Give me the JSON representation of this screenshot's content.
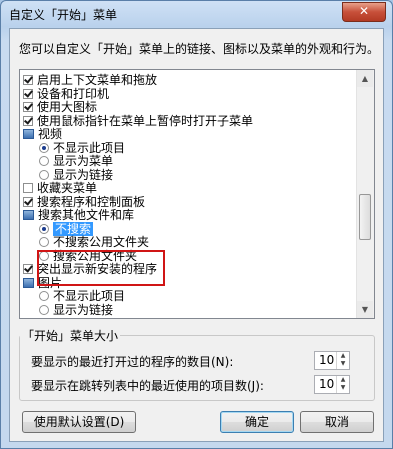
{
  "window": {
    "title": "自定义「开始」菜单",
    "close_glyph": "✕"
  },
  "description": "您可以自定义「开始」菜单上的链接、图标以及菜单的外观和行为。",
  "list_items": [
    {
      "kind": "checkbox",
      "checked": true,
      "label": "启用上下文菜单和拖放"
    },
    {
      "kind": "checkbox",
      "checked": true,
      "label": "设备和打印机"
    },
    {
      "kind": "checkbox",
      "checked": true,
      "label": "使用大图标"
    },
    {
      "kind": "checkbox",
      "checked": true,
      "label": "使用鼠标指针在菜单上暂停时打开子菜单"
    },
    {
      "kind": "group",
      "label": "视频"
    },
    {
      "kind": "radio",
      "checked": true,
      "label": "不显示此项目"
    },
    {
      "kind": "radio",
      "checked": false,
      "label": "显示为菜单"
    },
    {
      "kind": "radio",
      "checked": false,
      "label": "显示为链接"
    },
    {
      "kind": "checkbox",
      "checked": false,
      "label": "收藏夹菜单"
    },
    {
      "kind": "checkbox",
      "checked": true,
      "label": "搜索程序和控制面板"
    },
    {
      "kind": "group",
      "label": "搜索其他文件和库"
    },
    {
      "kind": "radio",
      "checked": true,
      "label": "不搜索",
      "selected": true
    },
    {
      "kind": "radio",
      "checked": false,
      "label": "不搜索公用文件夹"
    },
    {
      "kind": "radio",
      "checked": false,
      "label": "搜索公用文件夹"
    },
    {
      "kind": "checkbox",
      "checked": true,
      "label": "突出显示新安装的程序"
    },
    {
      "kind": "group",
      "label": "图片"
    },
    {
      "kind": "radio",
      "checked": false,
      "label": "不显示此项目"
    },
    {
      "kind": "radio",
      "checked": false,
      "label": "显示为链接"
    }
  ],
  "size_group": {
    "title": "「开始」菜单大小",
    "recent_programs_label": "要显示的最近打开过的程序的数目(N):",
    "recent_programs_value": "10",
    "jump_list_label": "要显示在跳转列表中的最近使用的项目数(J):",
    "jump_list_value": "10"
  },
  "buttons": {
    "defaults": "使用默认设置(D)",
    "ok": "确定",
    "cancel": "取消"
  },
  "icons": [
    "close-icon",
    "checkbox-icon",
    "radio-icon",
    "folder-icon",
    "scroll-up-icon",
    "scroll-down-icon",
    "spin-up-icon",
    "spin-down-icon"
  ],
  "colors": {
    "selection": "#3399ff",
    "highlight_box": "#d01515",
    "title_bar": "#b9d1ec"
  }
}
